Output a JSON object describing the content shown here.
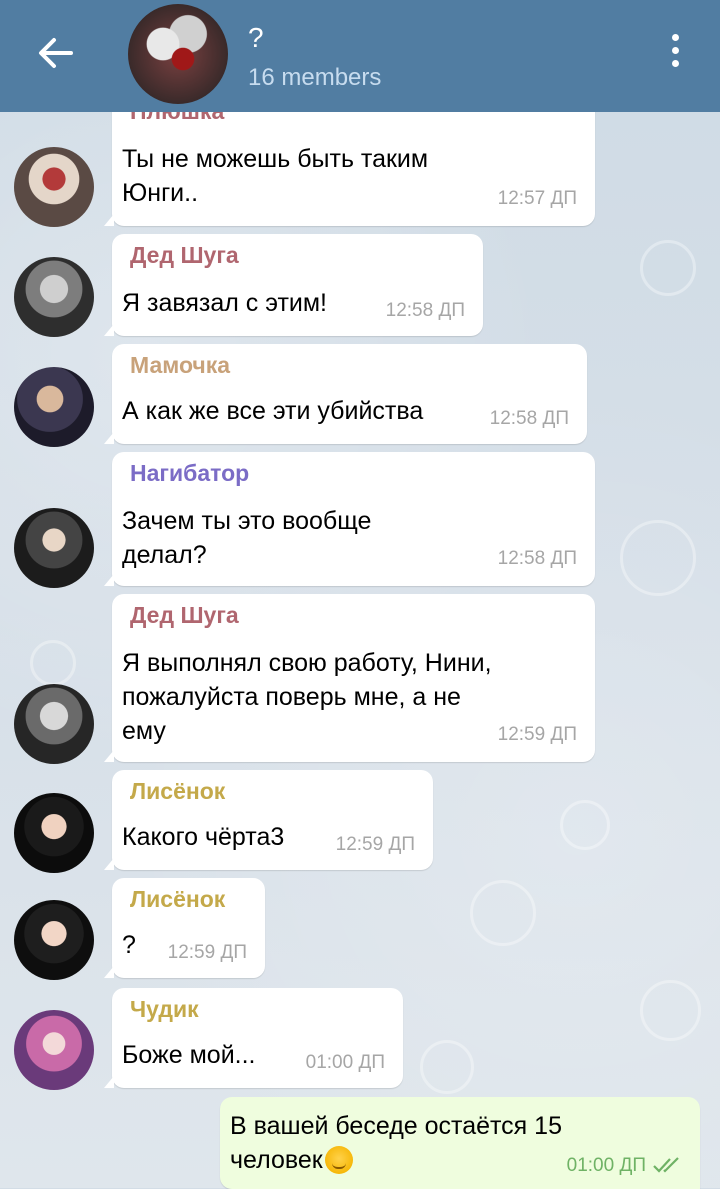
{
  "header": {
    "title": "?",
    "subtitle": "16 members",
    "back_icon": "arrow-left-icon",
    "menu_icon": "more-vertical-icon"
  },
  "partial_sender": "Плюшка",
  "messages": [
    {
      "sender": "",
      "text_lines": [
        "Ты не можешь быть таким",
        "Юнги.."
      ],
      "time": "12:57 ДП"
    },
    {
      "sender": "Дед Шуга",
      "sender_color": "#b0666f",
      "text_lines": [
        "Я завязал с этим!"
      ],
      "time": "12:58 ДП"
    },
    {
      "sender": "Мамочка",
      "sender_color": "#c8a27a",
      "text_lines": [
        "А как же все эти убийства"
      ],
      "time": "12:58 ДП"
    },
    {
      "sender": "Нагибатор",
      "sender_color": "#7b6cc6",
      "text_lines": [
        "Зачем ты это вообще",
        "делал?"
      ],
      "time": "12:58 ДП"
    },
    {
      "sender": "Дед Шуга",
      "sender_color": "#b0666f",
      "text_lines": [
        "Я выполнял свою работу, Нини,",
        "пожалуйста поверь мне, а не",
        "ему"
      ],
      "time": "12:59 ДП"
    },
    {
      "sender": "Лисёнок",
      "sender_color": "#c4a94a",
      "text_lines": [
        "Какого чёрта3"
      ],
      "time": "12:59 ДП"
    },
    {
      "sender": "Лисёнок",
      "sender_color": "#c4a94a",
      "text_lines": [
        "?"
      ],
      "time": "12:59 ДП"
    },
    {
      "sender": "Чудик",
      "sender_color": "#c4a94a",
      "text_lines": [
        "Боже мой..."
      ],
      "time": "01:00 ДП"
    }
  ],
  "outgoing": {
    "text_lines": [
      "В вашей беседе остаётся 15",
      "человек"
    ],
    "emoji": "smirk-emoji",
    "time": "01:00 ДП",
    "status_icon": "double-check-icon"
  }
}
